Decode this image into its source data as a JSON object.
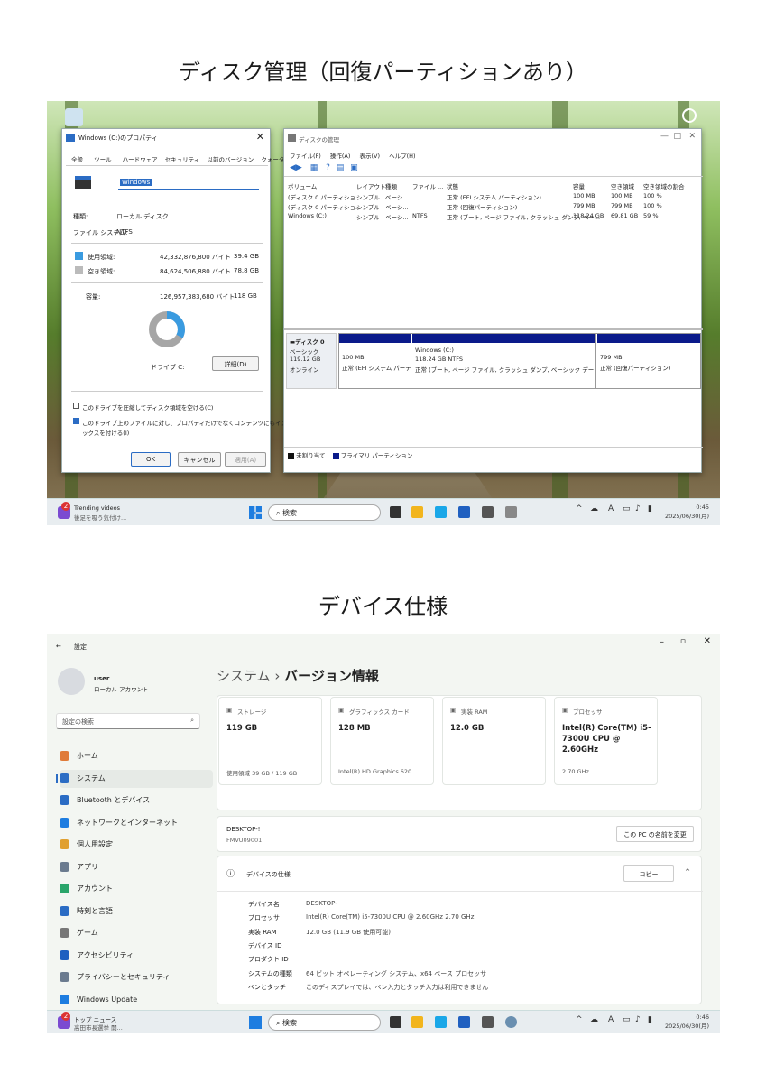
{
  "headings": {
    "top": "ディスク管理（回復パーティションあり）",
    "bottom": "デバイス仕様"
  },
  "props": {
    "title": "Windows (C:)のプロパティ",
    "tabs": [
      "全般",
      "ツール",
      "ハードウェア",
      "セキュリティ",
      "以前のバージョン",
      "クォータ"
    ],
    "name_value": "Windows",
    "type_label": "種類:",
    "type_value": "ローカル ディスク",
    "fs_label": "ファイル システム:",
    "fs_value": "NTFS",
    "used_label": "使用領域:",
    "used_bytes": "42,332,876,800 バイト",
    "used_gb": "39.4 GB",
    "free_label": "空き領域:",
    "free_bytes": "84,624,506,880 バイト",
    "free_gb": "78.8 GB",
    "cap_label": "容量:",
    "cap_bytes": "126,957,383,680 バイト",
    "cap_gb": "118 GB",
    "used_fraction": 0.33,
    "drive_label": "ドライブ C:",
    "detail_btn": "詳細(D)",
    "compress": "このドライブを圧縮してディスク領域を空ける(C)",
    "index1": "このドライブ上のファイルに対し、プロパティだけでなくコンテンツにもインデ",
    "index2": "ックスを付ける(I)",
    "ok": "OK",
    "cancel": "キャンセル",
    "apply": "適用(A)"
  },
  "dm": {
    "title": "ディスクの管理",
    "menu": [
      "ファイル(F)",
      "操作(A)",
      "表示(V)",
      "ヘルプ(H)"
    ],
    "cols": [
      "ボリューム",
      "レイアウト",
      "種類",
      "ファイル ...",
      "状態",
      "容量",
      "空き領域",
      "空き領域の割合"
    ],
    "rows": [
      [
        "(ディスク 0 パーティショ...",
        "シンプル",
        "ベーシ...",
        "",
        "正常 (EFI システム パーティション)",
        "100 MB",
        "100 MB",
        "100 %"
      ],
      [
        "(ディスク 0 パーティショ...",
        "シンプル",
        "ベーシ...",
        "",
        "正常 (回復パーティション)",
        "799 MB",
        "799 MB",
        "100 %"
      ],
      [
        "Windows (C:)",
        "シンプル",
        "ベーシ...",
        "NTFS",
        "正常 (ブート, ページ ファイル, クラッシュ ダンプ, ベー...",
        "118.24 GB",
        "69.81 GB",
        "59 %"
      ]
    ],
    "disk_name": "ディスク 0",
    "disk_type": "ベーシック",
    "disk_size": "119.12 GB",
    "disk_status": "オンライン",
    "p1_size": "100 MB",
    "p1_status": "正常 (EFI システム パーティ",
    "p2_name": "Windows (C:)",
    "p2_size": "118.24 GB NTFS",
    "p2_status": "正常 (ブート, ページ ファイル, クラッシュ ダンプ, ベーシック データ パーティション",
    "p3_size": "799 MB",
    "p3_status": "正常 (回復パーティション)",
    "legend_unalloc": "未割り当て",
    "legend_primary": "プライマリ パーティション"
  },
  "taskbar1": {
    "news_title": "Trending videos",
    "news_sub": "後足を吸う気付け...",
    "badge": "2",
    "search": "検索",
    "time": "0:45",
    "date": "2025/06/30(月)"
  },
  "settings": {
    "back_title": "設定",
    "user_name": "user",
    "user_sub": "ローカル アカウント",
    "search_placeholder": "設定の検索",
    "nav": [
      "ホーム",
      "システム",
      "Bluetooth とデバイス",
      "ネットワークとインターネット",
      "個人用設定",
      "アプリ",
      "アカウント",
      "時刻と言語",
      "ゲーム",
      "アクセシビリティ",
      "プライバシーとセキュリティ",
      "Windows Update"
    ],
    "breadcrumb_parent": "システム",
    "breadcrumb_sep": "›",
    "breadcrumb_current": "バージョン情報",
    "cards": [
      {
        "label": "ストレージ",
        "value": "119 GB",
        "sub": "使用領域 39 GB / 119 GB"
      },
      {
        "label": "グラフィックス カード",
        "value": "128 MB",
        "sub": "Intel(R) HD Graphics 620"
      },
      {
        "label": "実装 RAM",
        "value": "12.0 GB",
        "sub": ""
      },
      {
        "label": "プロセッサ",
        "value": "Intel(R) Core(TM) i5-7300U CPU @ 2.60GHz",
        "sub": "2.70 GHz"
      }
    ],
    "device_name": "DESKTOP-!",
    "device_model": "FMVU09001",
    "rename_btn": "この PC の名前を変更",
    "spec_title": "デバイスの仕様",
    "copy_btn": "コピー",
    "specs": [
      [
        "デバイス名",
        "DESKTOP-"
      ],
      [
        "プロセッサ",
        "Intel(R) Core(TM) i5-7300U CPU @ 2.60GHz   2.70 GHz"
      ],
      [
        "実装 RAM",
        "12.0 GB (11.9 GB 使用可能)"
      ],
      [
        "デバイス ID",
        ""
      ],
      [
        "プロダクト ID",
        ""
      ],
      [
        "システムの種類",
        "64 ビット オペレーティング システム、x64 ベース プロセッサ"
      ],
      [
        "ペンとタッチ",
        "このディスプレイでは、ペン入力とタッチ入力は利用できません"
      ]
    ]
  },
  "taskbar2": {
    "news_title": "トップ ニュース",
    "news_sub": "高田市長選挙 開...",
    "badge": "2",
    "search": "検索",
    "time": "0:46",
    "date": "2025/06/30(月)"
  }
}
